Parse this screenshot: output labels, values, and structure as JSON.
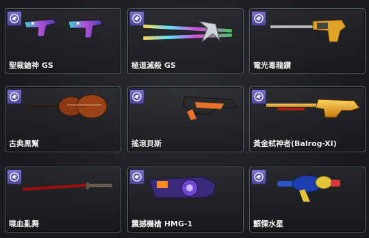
{
  "top_strip": "",
  "items": [
    {
      "name": "聖裁鎗神 GS",
      "icon": "dual-pistols-icon"
    },
    {
      "name": "極道滅殺 GS",
      "icon": "twin-blade-staff-icon"
    },
    {
      "name": "電光毒龍鑽",
      "icon": "power-drill-icon"
    },
    {
      "name": "古典黑幫",
      "icon": "violin-icon"
    },
    {
      "name": "搖滾貝斯",
      "icon": "bass-guitar-rifle-icon"
    },
    {
      "name": "黃金弒神者(Balrog-XI)",
      "icon": "golden-shotgun-icon"
    },
    {
      "name": "喋血亂舞",
      "icon": "red-katana-icon"
    },
    {
      "name": "震撼機槍 HMG-1",
      "icon": "heavy-machine-gun-icon"
    },
    {
      "name": "顫慄水星",
      "icon": "water-gun-icon"
    }
  ],
  "badge_icon": "weapon-class-icon",
  "colors": {
    "card_border": "#5b5f66",
    "badge": "#6a62bd",
    "text": "#f1f1f1"
  }
}
